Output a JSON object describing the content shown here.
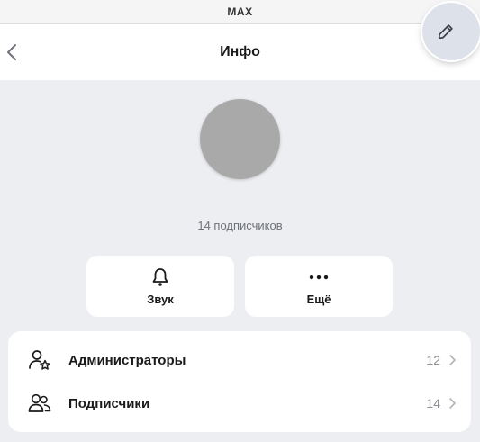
{
  "app": {
    "title": "MAX"
  },
  "header": {
    "title": "Инфо"
  },
  "profile": {
    "subscribers_text": "14 подписчиков"
  },
  "actions": {
    "sound_label": "Звук",
    "more_label": "Ещё"
  },
  "list": {
    "items": [
      {
        "label": "Администраторы",
        "count": "12",
        "icon": "admin-star-icon"
      },
      {
        "label": "Подписчики",
        "count": "14",
        "icon": "people-icon"
      }
    ]
  },
  "colors": {
    "background": "#edeef2",
    "card": "#ffffff",
    "avatar": "#a9a9a9",
    "edit_button": "#dde1ea",
    "muted_text": "#6f727a"
  },
  "icons": {
    "back": "chevron-left-icon",
    "edit": "pencil-icon",
    "sound": "bell-icon",
    "more": "dots-icon",
    "row_chevron": "chevron-right-icon"
  }
}
